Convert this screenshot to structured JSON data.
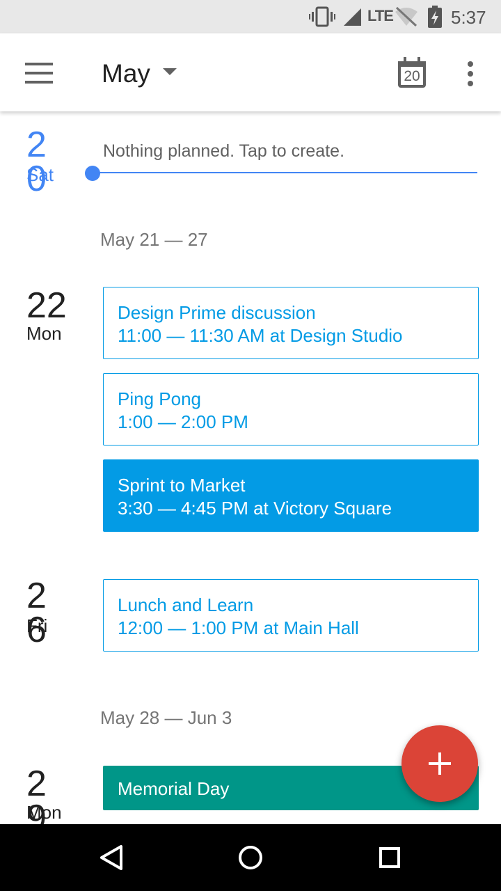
{
  "status_bar": {
    "network": "LTE",
    "time": "5:37",
    "icons": [
      "vibrate-icon",
      "cell-signal-icon",
      "wifi-off-icon",
      "battery-charging-icon"
    ]
  },
  "app_bar": {
    "month": "May",
    "today_number": "20",
    "icons": [
      "menu-icon",
      "dropdown-caret-icon",
      "calendar-today-icon",
      "more-vert-icon"
    ]
  },
  "agenda": {
    "today": {
      "day": "20",
      "weekday": "Sat",
      "empty_text": "Nothing planned. Tap to create."
    },
    "weeks": [
      {
        "label": "May 21 — 27"
      },
      {
        "label": "May 28 — Jun 3"
      }
    ],
    "days": [
      {
        "day": "22",
        "weekday": "Mon",
        "events": [
          {
            "title": "Design Prime discussion",
            "when": "11:00 — 11:30 AM at Design Studio"
          },
          {
            "title": "Ping Pong",
            "when": "1:00 — 2:00 PM"
          },
          {
            "title": "Sprint to Market",
            "when": "3:30 — 4:45 PM at Victory Square"
          }
        ]
      },
      {
        "day": "26",
        "weekday": "Fri",
        "events": [
          {
            "title": "Lunch and Learn",
            "when": "12:00 — 1:00 PM at Main Hall"
          }
        ]
      },
      {
        "day": "29",
        "weekday": "Mon",
        "events": [
          {
            "title": "Memorial Day"
          }
        ]
      }
    ]
  },
  "fab": {
    "icon": "add-icon"
  },
  "nav_bar": {
    "icons": [
      "back-icon",
      "home-icon",
      "recents-icon"
    ]
  },
  "colors": {
    "accent_blue": "#4285f4",
    "event_blue": "#039be5",
    "holiday_teal": "#009688",
    "fab_red": "#db4437"
  }
}
